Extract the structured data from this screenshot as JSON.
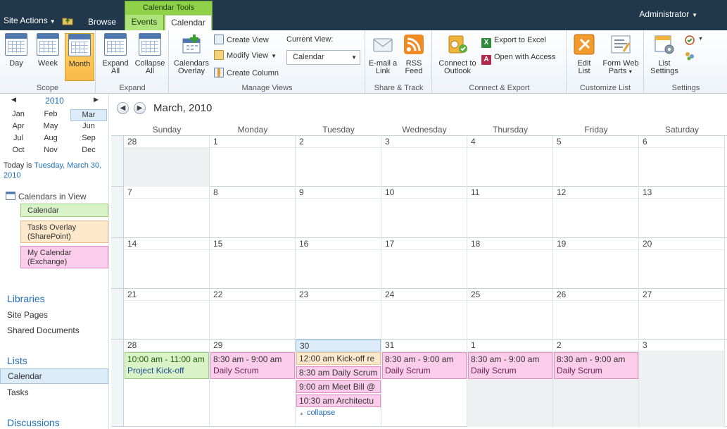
{
  "topbar": {
    "site_actions": "Site Actions",
    "browse_tab": "Browse",
    "context_group": "Calendar Tools",
    "events_tab": "Events",
    "calendar_tab": "Calendar",
    "user": "Administrator"
  },
  "ribbon": {
    "scope": {
      "label": "Scope",
      "day": "Day",
      "week": "Week",
      "month": "Month"
    },
    "expand": {
      "label": "Expand",
      "expand_all_1": "Expand",
      "expand_all_2": "All",
      "collapse_all_1": "Collapse",
      "collapse_all_2": "All"
    },
    "manage_views": {
      "label": "Manage Views",
      "calendars_overlay_1": "Calendars",
      "calendars_overlay_2": "Overlay",
      "create_view": "Create View",
      "modify_view": "Modify View",
      "create_column": "Create Column",
      "current_view_label": "Current View:",
      "current_view_value": "Calendar"
    },
    "share_track": {
      "label": "Share & Track",
      "email_link_1": "E-mail a",
      "email_link_2": "Link",
      "rss_feed_1": "RSS",
      "rss_feed_2": "Feed"
    },
    "connect_export": {
      "label": "Connect & Export",
      "connect_outlook_1": "Connect to",
      "connect_outlook_2": "Outlook",
      "export_excel": "Export to Excel",
      "open_access": "Open with Access"
    },
    "customize_list": {
      "label": "Customize List",
      "edit_list_1": "Edit",
      "edit_list_2": "List",
      "form_web_parts_1": "Form Web",
      "form_web_parts_2": "Parts"
    },
    "settings": {
      "label": "Settings",
      "list_settings_1": "List",
      "list_settings_2": "Settings"
    }
  },
  "datepicker": {
    "year": "2010",
    "months": [
      "Jan",
      "Feb",
      "Mar",
      "Apr",
      "May",
      "Jun",
      "Jul",
      "Aug",
      "Sep",
      "Oct",
      "Nov",
      "Dec"
    ],
    "selected": "Mar"
  },
  "today": {
    "prefix": "Today is ",
    "date_1": "Tuesday, March 30,",
    "date_2": "2010"
  },
  "calendars_in_view": {
    "heading": "Calendars in View",
    "items": [
      {
        "line1": "Calendar",
        "line2": ""
      },
      {
        "line1": "Tasks Overlay",
        "line2": "(SharePoint)"
      },
      {
        "line1": "My Calendar",
        "line2": "(Exchange)"
      }
    ]
  },
  "quicklaunch": {
    "libraries": "Libraries",
    "site_pages": "Site Pages",
    "shared_documents": "Shared Documents",
    "lists": "Lists",
    "calendar": "Calendar",
    "tasks": "Tasks",
    "discussions": "Discussions"
  },
  "calendar": {
    "title": "March, 2010",
    "days_of_week": [
      "Sunday",
      "Monday",
      "Tuesday",
      "Wednesday",
      "Thursday",
      "Friday",
      "Saturday"
    ],
    "weeks": [
      [
        "28",
        "1",
        "2",
        "3",
        "4",
        "5",
        "6"
      ],
      [
        "7",
        "8",
        "9",
        "10",
        "11",
        "12",
        "13"
      ],
      [
        "14",
        "15",
        "16",
        "17",
        "18",
        "19",
        "20"
      ],
      [
        "21",
        "22",
        "23",
        "24",
        "25",
        "26",
        "27"
      ],
      [
        "28",
        "29",
        "30",
        "31",
        "1",
        "2",
        "3"
      ]
    ],
    "events": {
      "sun28": {
        "time": "10:00 am - 11:00 am",
        "name": "Project Kick-off"
      },
      "mon29": {
        "time": "8:30 am - 9:00 am",
        "name": "Daily Scrum"
      },
      "tue30_1": "12:00 am Kick-off re",
      "tue30_2": "8:30 am Daily Scrum",
      "tue30_3": "9:00 am Meet Bill @",
      "tue30_4": "10:30 am Architectu",
      "wed31": {
        "time": "8:30 am - 9:00 am",
        "name": "Daily Scrum"
      },
      "thu1": {
        "time": "8:30 am - 9:00 am",
        "name": "Daily Scrum"
      },
      "fri2": {
        "time": "8:30 am - 9:00 am",
        "name": "Daily Scrum"
      }
    },
    "collapse": "collapse"
  }
}
